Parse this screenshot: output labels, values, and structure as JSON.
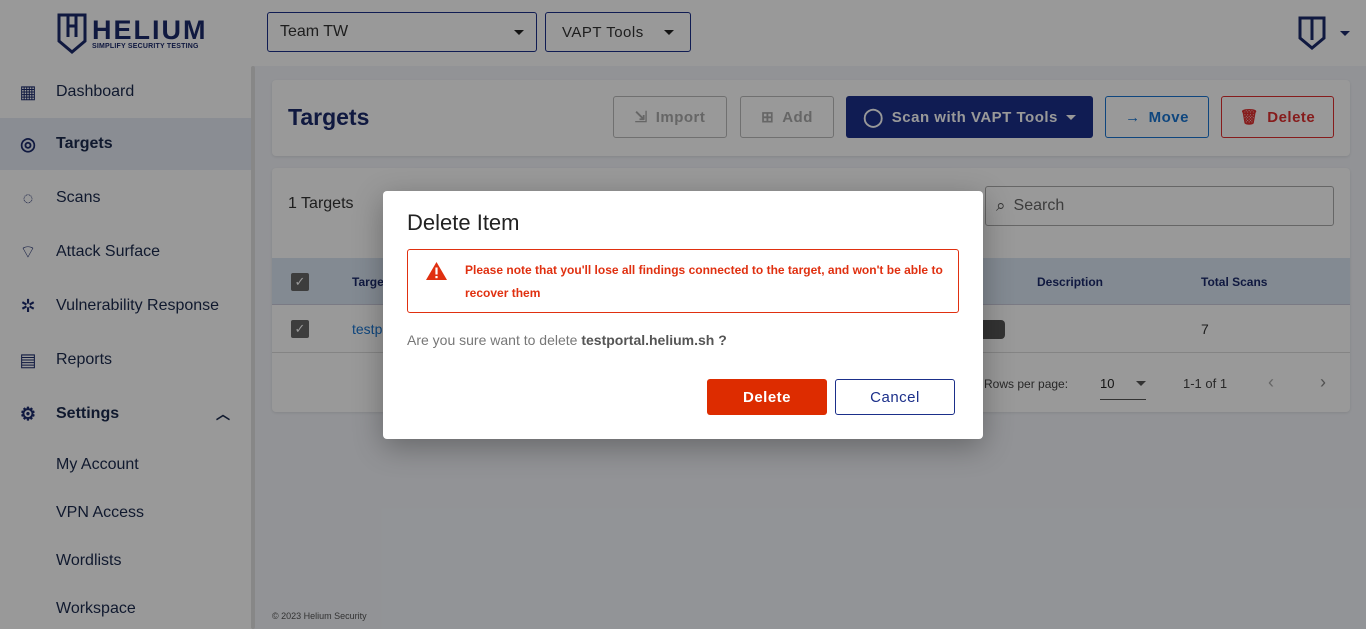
{
  "brand": {
    "name": "HELIUM",
    "tagline": "SIMPLIFY SECURITY TESTING"
  },
  "header": {
    "team_select": "Team TW",
    "tools_select": "VAPT Tools"
  },
  "sidebar": {
    "items": [
      {
        "label": "Dashboard",
        "icon": "dashboard-icon"
      },
      {
        "label": "Targets",
        "icon": "target-icon",
        "active": true
      },
      {
        "label": "Scans",
        "icon": "scans-icon"
      },
      {
        "label": "Attack Surface",
        "icon": "attack-surface-icon"
      },
      {
        "label": "Vulnerability Response",
        "icon": "bug-icon"
      },
      {
        "label": "Reports",
        "icon": "report-icon"
      },
      {
        "label": "Settings",
        "icon": "gear-icon",
        "expanded": true
      }
    ],
    "settings_items": [
      "My Account",
      "VPN Access",
      "Wordlists",
      "Workspace"
    ]
  },
  "page": {
    "title": "Targets",
    "import": "Import",
    "add": "Add",
    "scan": "Scan with VAPT Tools",
    "move": "Move",
    "delete": "Delete"
  },
  "table": {
    "count": "1 Targets",
    "search_placeholder": "Search",
    "columns": [
      "Target",
      "Description",
      "Total Scans"
    ],
    "rows": [
      {
        "target": "testportal.helium.sh",
        "total_scans": "7",
        "checked": true
      }
    ],
    "rows_per_page_label": "Rows per page:",
    "rows_per_page": "10",
    "range": "1-1 of 1"
  },
  "footer": "© 2023 Helium Security",
  "modal": {
    "title": "Delete Item",
    "warning": "Please note that you'll lose all findings connected to the target, and won't be able to recover them",
    "question": "Are you sure want to delete",
    "item": "testportal.helium.sh ?",
    "confirm": "Delete",
    "cancel": "Cancel"
  },
  "colors": {
    "brand": "#1b2a6b",
    "primary": "#1b2f8a",
    "danger": "#e03010",
    "move": "#1976d2"
  }
}
